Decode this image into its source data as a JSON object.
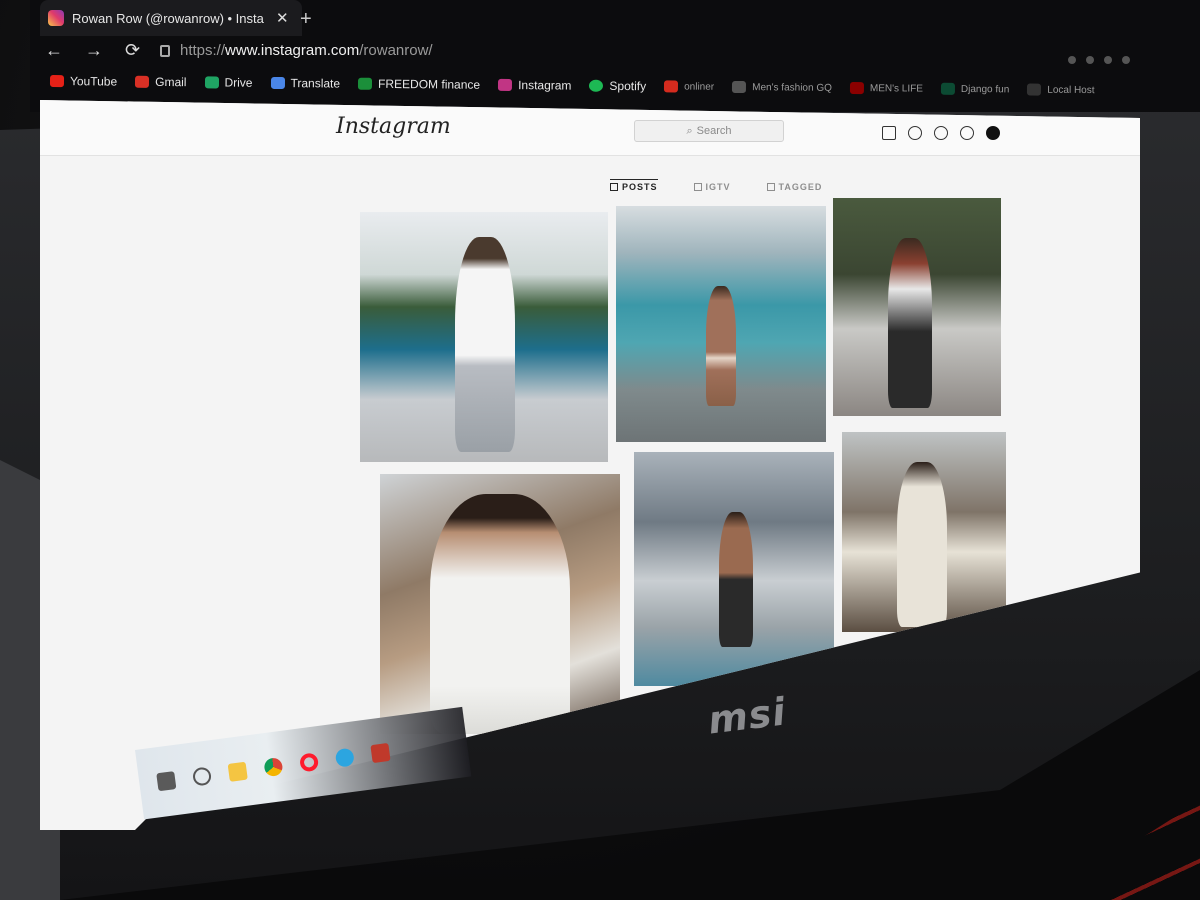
{
  "browser": {
    "tab_title": "Rowan Row (@rowanrow) • Insta",
    "close_glyph": "✕",
    "new_tab_glyph": "+",
    "nav": {
      "back": "←",
      "forward": "→",
      "reload": "⟳"
    },
    "url_prefix": "https://",
    "url_host": "www.instagram.com",
    "url_path": "/rowanrow/"
  },
  "bookmarks": [
    {
      "label": "YouTube",
      "color": "#e62117"
    },
    {
      "label": "Gmail",
      "color": "#d93025"
    },
    {
      "label": "Drive",
      "color": "#1fa463"
    },
    {
      "label": "Translate",
      "color": "#4a86e8"
    },
    {
      "label": "FREEDOM finance",
      "color": "#1b8f3a"
    },
    {
      "label": "Instagram",
      "color": "#c13584"
    },
    {
      "label": "Spotify",
      "color": "#1db954"
    },
    {
      "label": "onliner",
      "color": "#d52b1e"
    },
    {
      "label": "Men's fashion GQ",
      "color": "#555555"
    },
    {
      "label": "MEN's LIFE",
      "color": "#8b0000"
    },
    {
      "label": "Django fun",
      "color": "#0c4b33"
    },
    {
      "label": "Local Host",
      "color": "#333333"
    }
  ],
  "instagram": {
    "logo": "Instagram",
    "search_placeholder": "Search",
    "tabs": [
      "POSTS",
      "IGTV",
      "TAGGED"
    ]
  },
  "hardware": {
    "brand": "msi"
  },
  "colors": {
    "keyboard_backlight": "#ff2a1e",
    "ig_gradient": "#c13584"
  },
  "icons": [
    "home-icon",
    "messenger-icon",
    "explore-icon",
    "heart-icon",
    "profile-avatar",
    "windows-start-icon",
    "search-icon",
    "file-explorer-icon",
    "chrome-icon",
    "opera-icon",
    "telegram-icon"
  ]
}
